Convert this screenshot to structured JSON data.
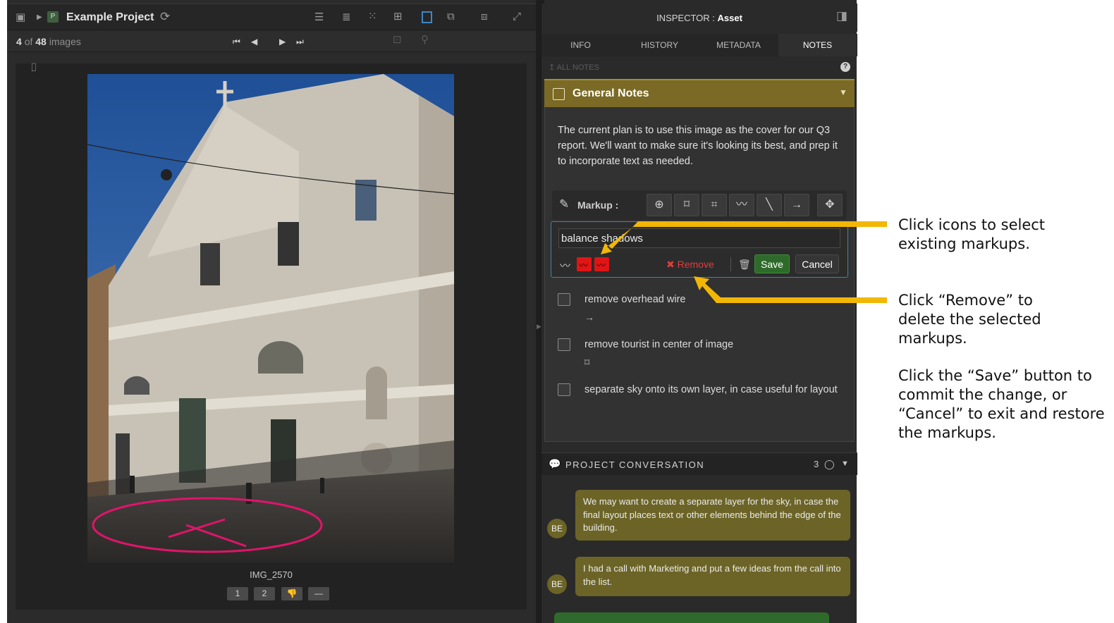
{
  "viewer": {
    "project_title": "Example Project",
    "counter": {
      "current": "4",
      "of": "of",
      "total": "48",
      "unit": "images"
    },
    "image_name": "IMG_2570",
    "rating_buttons": [
      "1",
      "2",
      "👎",
      "—"
    ]
  },
  "inspector": {
    "title_prefix": "INSPECTOR : ",
    "title_value": "Asset",
    "tabs": [
      {
        "label": "INFO",
        "active": false
      },
      {
        "label": "HISTORY",
        "active": false
      },
      {
        "label": "METADATA",
        "active": false
      },
      {
        "label": "NOTES",
        "active": true
      }
    ],
    "all_notes": "ALL NOTES",
    "help": "?",
    "general_notes": {
      "title": "General Notes",
      "text": "The current plan is to use this image as the cover for our Q3 report. We'll want to make sure it's looking its best, and prep it to incorporate text as needed.",
      "markup_label": "Markup :",
      "editor": {
        "value": "balance shadows",
        "remove_label": "Remove",
        "save_label": "Save",
        "cancel_label": "Cancel"
      },
      "todos": [
        {
          "label": "remove overhead wire",
          "markup_icon": "→",
          "checked": false
        },
        {
          "label": "remove tourist in center of image",
          "markup_icon": "⌑",
          "checked": false
        },
        {
          "label": "separate sky onto its own layer, in case useful for layout",
          "markup_icon": "",
          "checked": false
        }
      ]
    },
    "conversation": {
      "title": "PROJECT CONVERSATION",
      "count": "3",
      "messages": [
        {
          "author": "BE",
          "text": "We may want to create a separate layer for the sky, in case the final layout places text or other elements behind the edge of the building."
        },
        {
          "author": "BE",
          "text": "I had a call with Marketing and put a few ideas from the call into the list."
        }
      ]
    }
  },
  "annotations": {
    "note1": "Click icons to select existing markups.",
    "note2": "Click “Remove” to delete the selected markups.",
    "note3": "Click the “Save” button to commit the change, or “Cancel” to exit and restore the markups."
  },
  "colors": {
    "accent_gold": "#7a6a25",
    "bubble": "#6c6427",
    "editor_border": "#3d86a8",
    "markup_red": "#e01515",
    "save_green": "#2e6b2a",
    "arrow": "#f2b705"
  }
}
